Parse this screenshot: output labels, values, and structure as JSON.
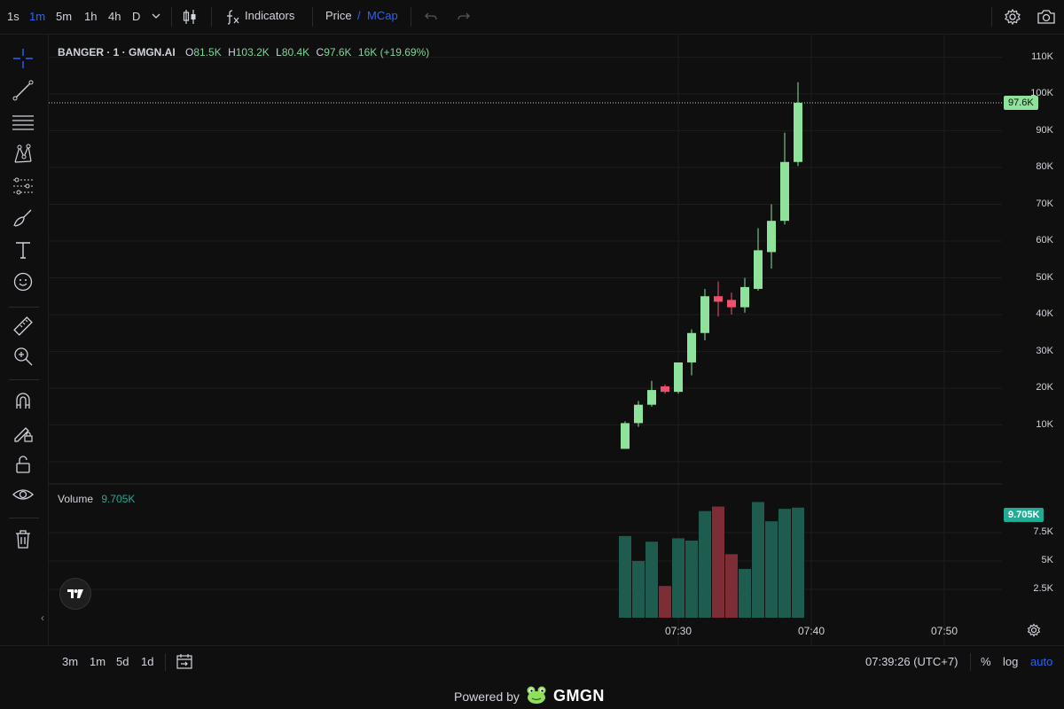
{
  "toolbar": {
    "timeframes": [
      "1s",
      "1m",
      "5m",
      "1h",
      "4h",
      "D"
    ],
    "active_timeframe": "1m",
    "indicators_label": "Indicators",
    "price_label": "Price",
    "slash": "/",
    "mcap_label": "MCap"
  },
  "left_tools": [
    "crosshair-icon",
    "trend-line-icon",
    "horizontal-lines-icon",
    "pattern-icon",
    "fib-channel-icon",
    "brush-icon",
    "text-icon",
    "emoji-icon",
    "ruler-icon",
    "zoom-in-icon",
    "magnet-icon",
    "lock-drawing-icon",
    "unlock-icon",
    "eye-icon",
    "trash-icon"
  ],
  "legend": {
    "symbol": "BANGER · 1 · GMGN.AI",
    "o_key": "O",
    "o_val": "81.5K",
    "h_key": "H",
    "h_val": "103.2K",
    "l_key": "L",
    "l_val": "80.4K",
    "c_key": "C",
    "c_val": "97.6K",
    "change": "16K (+19.69%)"
  },
  "volume_legend": {
    "label": "Volume",
    "value": "9.705K"
  },
  "price_axis": {
    "labels": [
      "110K",
      "100K",
      "90K",
      "80K",
      "70K",
      "60K",
      "50K",
      "40K",
      "30K",
      "20K",
      "10K"
    ],
    "current_price": "97.6K"
  },
  "volume_axis": {
    "labels": [
      "7.5K",
      "5K",
      "2.5K"
    ],
    "current_volume": "9.705K"
  },
  "time_axis": {
    "labels": [
      "07:30",
      "07:40",
      "07:50"
    ]
  },
  "bottom_bar": {
    "ranges": [
      "3m",
      "1m",
      "5d",
      "1d"
    ],
    "clock": "07:39:26 (UTC+7)",
    "percent": "%",
    "log": "log",
    "auto": "auto"
  },
  "footer": {
    "powered_by": "Powered by",
    "brand": "GMGN"
  },
  "colors": {
    "up": "#8ee29b",
    "down": "#f0506e",
    "vol_up": "#1d5c4e",
    "vol_down": "#7d2d36",
    "accent": "#2962ff"
  },
  "chart_data": {
    "type": "candlestick",
    "interval": "1m",
    "candles": [
      {
        "o": 3.5,
        "h": 11,
        "l": 3.5,
        "c": 10.5
      },
      {
        "o": 10.5,
        "h": 16.5,
        "l": 9.5,
        "c": 15.5
      },
      {
        "o": 15.5,
        "h": 22,
        "l": 15,
        "c": 19.5
      },
      {
        "o": 20.5,
        "h": 21,
        "l": 18.5,
        "c": 19
      },
      {
        "o": 19,
        "h": 27,
        "l": 18.5,
        "c": 27
      },
      {
        "o": 27,
        "h": 36,
        "l": 23.5,
        "c": 35
      },
      {
        "o": 35,
        "h": 47,
        "l": 33,
        "c": 45
      },
      {
        "o": 45,
        "h": 49,
        "l": 39.5,
        "c": 43.5
      },
      {
        "o": 44,
        "h": 46,
        "l": 40,
        "c": 42
      },
      {
        "o": 42,
        "h": 50,
        "l": 40.5,
        "c": 47.5
      },
      {
        "o": 47,
        "h": 63.5,
        "l": 46.5,
        "c": 57.5
      },
      {
        "o": 57,
        "h": 70,
        "l": 52.5,
        "c": 65.5
      },
      {
        "o": 65.5,
        "h": 89.5,
        "l": 64.5,
        "c": 81.5
      },
      {
        "o": 81.5,
        "h": 103.2,
        "l": 80.4,
        "c": 97.6
      }
    ],
    "volumes": [
      7.2,
      5.0,
      6.7,
      2.8,
      7.0,
      6.8,
      9.4,
      9.8,
      5.6,
      4.3,
      10.2,
      8.5,
      9.6,
      9.705
    ],
    "y_range": [
      0,
      110000
    ],
    "volume_range": [
      0,
      10000
    ],
    "x_labels": [
      "07:30",
      "07:40",
      "07:50"
    ]
  }
}
